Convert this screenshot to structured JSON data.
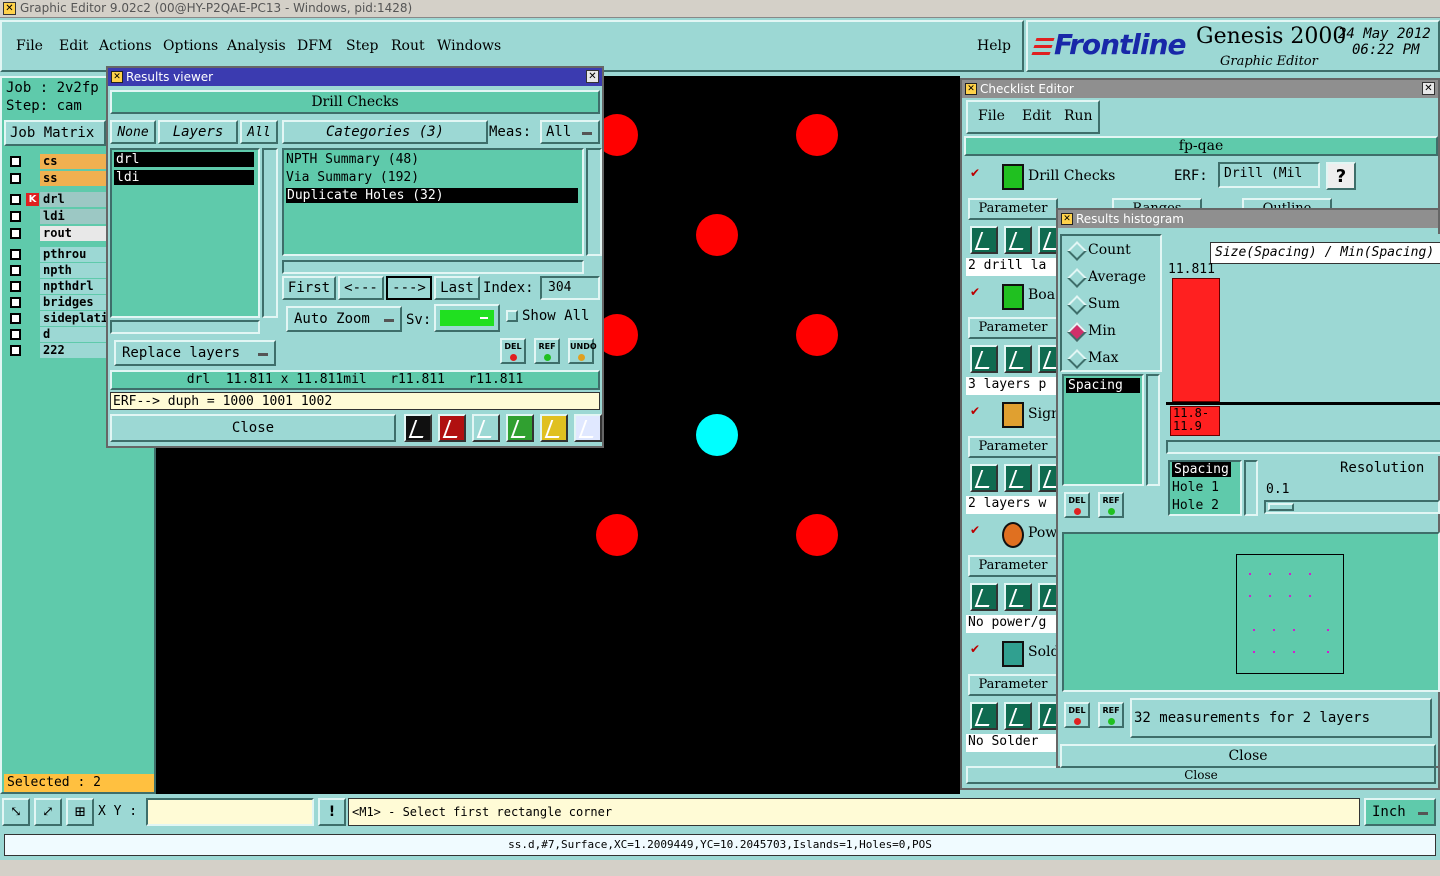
{
  "window": {
    "title": "Graphic Editor 9.02c2 (00@HY-P2QAE-PC13 - Windows, pid:1428)"
  },
  "menu": {
    "items": [
      "File",
      "Edit",
      "Actions",
      "Options",
      "Analysis",
      "DFM",
      "Step",
      "Rout",
      "Windows"
    ],
    "help": "Help"
  },
  "brand": {
    "logo": "Frontline",
    "product": "Genesis 2000",
    "subtitle": "Graphic Editor",
    "date": "24 May 2012",
    "time": "06:22 PM"
  },
  "leftpanel": {
    "job": "Job : 2v2fp",
    "step": "Step: cam",
    "job_matrix": "Job Matrix",
    "layers": [
      {
        "name": "cs"
      },
      {
        "name": "ss"
      },
      {
        "name": "drl"
      },
      {
        "name": "ldi"
      },
      {
        "name": "rout"
      },
      {
        "name": "pthrou"
      },
      {
        "name": "npth"
      },
      {
        "name": "npthdrl"
      },
      {
        "name": "bridges"
      },
      {
        "name": "sideplati"
      },
      {
        "name": "d"
      },
      {
        "name": "222"
      }
    ],
    "selected": "Selected : 2"
  },
  "results_viewer": {
    "title": "Results viewer",
    "header": "Drill Checks",
    "none": "None",
    "layers": "Layers",
    "all": "All",
    "categories": "Categories (3)",
    "meas_label": "Meas:",
    "meas_value": "All",
    "layer_list": [
      "drl",
      "ldi"
    ],
    "category_list": [
      "NPTH Summary (48)",
      "Via Summary (192)",
      "Duplicate Holes (32)"
    ],
    "first": "First",
    "prev": "<---",
    "next": "--->",
    "last": "Last",
    "index_label": "Index:",
    "index_value": "304",
    "auto_zoom": "Auto Zoom",
    "sv_label": "Sv:",
    "show_all": "Show All",
    "replace_layers": "Replace layers",
    "del": "DEL",
    "ref": "REF",
    "undo": "UNDO",
    "info": "drl  11.811 x 11.811mil   r11.811   r11.811",
    "erf": "ERF--> duph = 1000 1001 1002",
    "close": "Close"
  },
  "checklist_editor": {
    "title": "Checklist Editor",
    "menu": [
      "File",
      "Edit",
      "Run"
    ],
    "name": "fp-qae",
    "erf_label": "ERF:",
    "erf_value": "Drill (Mil",
    "help_btn": "?",
    "actions": [
      {
        "name": "Drill Checks",
        "summary": "2 drill la"
      },
      {
        "name": "Boa",
        "summary": "3 layers p"
      },
      {
        "name": "Sign",
        "summary": "2 layers w"
      },
      {
        "name": "Pow",
        "summary": "No power/g"
      },
      {
        "name": "Sold",
        "summary": "No Solder"
      }
    ],
    "parameters": "Parameter",
    "ranges": "Ranges",
    "outline": "Outline",
    "close": "Close"
  },
  "histogram": {
    "title": "Results histogram",
    "modes": [
      "Count",
      "Average",
      "Sum",
      "Min",
      "Max"
    ],
    "selected_mode": "Min",
    "chart_title": "Size(Spacing) / Min(Spacing)",
    "value_label": "11.811",
    "bar_range_top": "11.8-",
    "bar_range_bottom": "11.9",
    "list_item": "Spacing",
    "fields": [
      "Spacing",
      "Hole 1",
      "Hole 2"
    ],
    "resolution_label": "Resolution",
    "resolution_value": "0.1",
    "summary": "32 measurements for 2 layers",
    "close": "Close"
  },
  "bottombar": {
    "xy_label": "X Y :",
    "prompt": "<M1> - Select first rectangle corner",
    "units": "Inch",
    "status": "ss.d,#7,Surface,XC=1.2009449,YC=10.2045703,Islands=1,Holes=0,POS"
  },
  "colors": {
    "panel": "#9cd8d4",
    "green": "#5fcaab",
    "hole": "#ff0000",
    "highlight": "#00ffff",
    "canvas": "#000000"
  }
}
